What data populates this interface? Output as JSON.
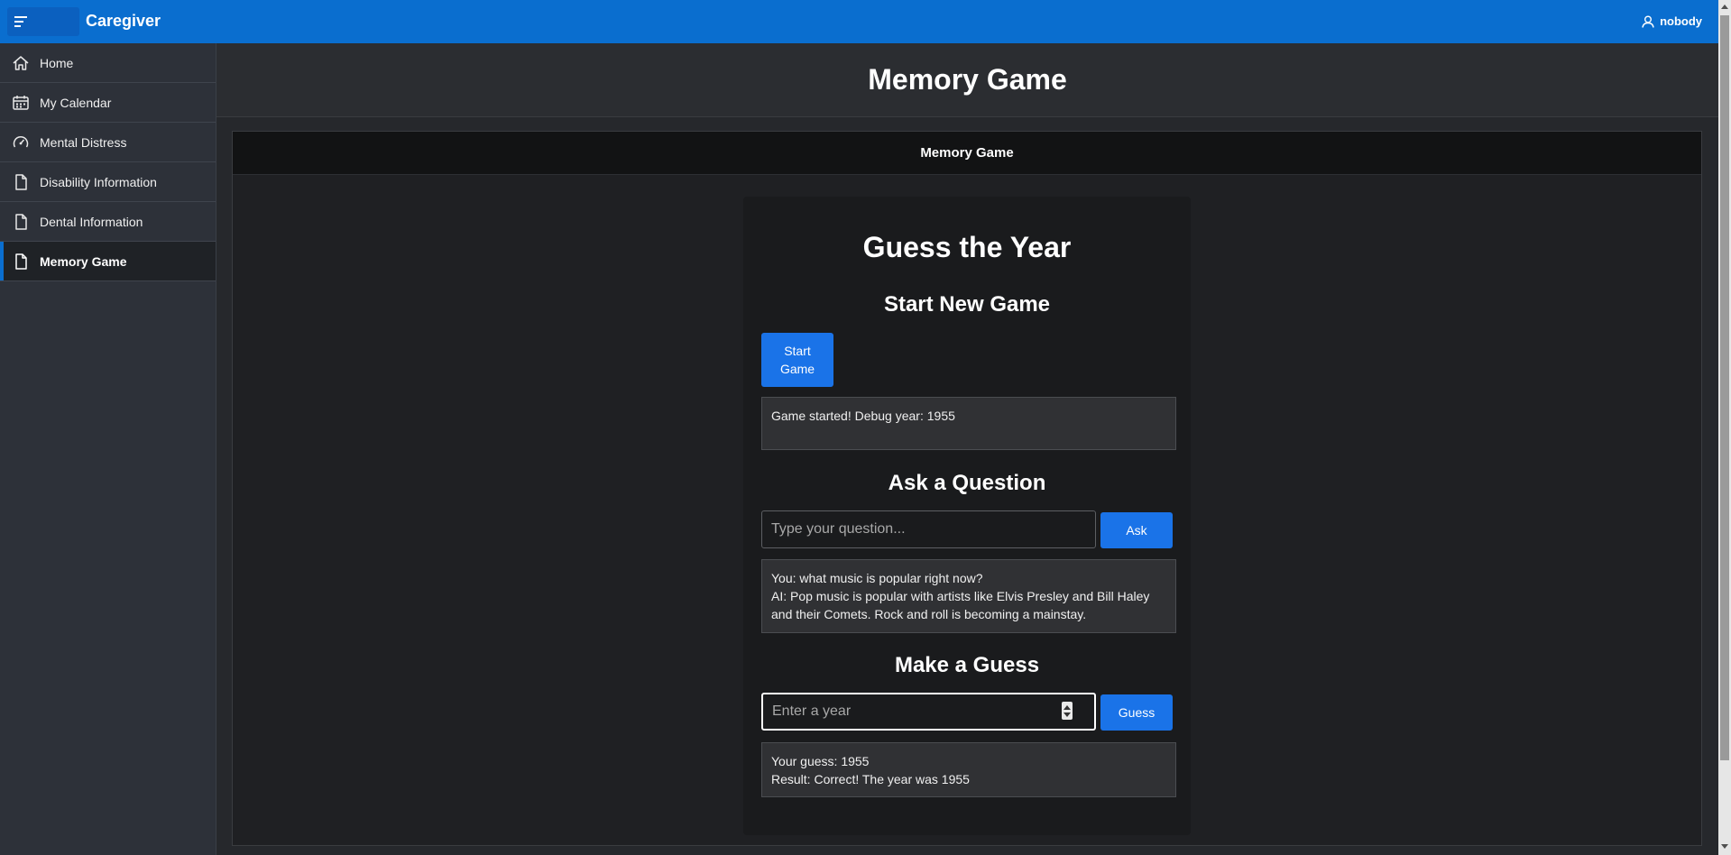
{
  "topbar": {
    "app_title": "Caregiver",
    "menu_icon": "hamburger-menu-icon",
    "user_icon": "user-icon",
    "user_name": "nobody",
    "accent_color": "#0a6ecf"
  },
  "sidebar": {
    "items": [
      {
        "label": "Home",
        "icon": "home-icon",
        "active": false
      },
      {
        "label": "My Calendar",
        "icon": "calendar-icon",
        "active": false
      },
      {
        "label": "Mental Distress",
        "icon": "gauge-icon",
        "active": false
      },
      {
        "label": "Disability Information",
        "icon": "document-icon",
        "active": false
      },
      {
        "label": "Dental Information",
        "icon": "document-icon",
        "active": false
      },
      {
        "label": "Memory Game",
        "icon": "document-icon",
        "active": true
      }
    ]
  },
  "page": {
    "title": "Memory Game",
    "region_title": "Memory Game"
  },
  "game": {
    "title": "Guess the Year",
    "start_section": "Start New Game",
    "start_button": "Start Game",
    "status_text": "Game started! Debug year: 1955",
    "ask_section": "Ask a Question",
    "question_placeholder": "Type your question...",
    "question_value": "",
    "ask_button": "Ask",
    "conversation": {
      "you_line": "You: what music is popular right now?",
      "ai_line": "AI: Pop music is popular with artists like Elvis Presley and Bill Haley and their Comets. Rock and roll is becoming a mainstay."
    },
    "guess_section": "Make a Guess",
    "year_placeholder": "Enter a year",
    "year_value": "",
    "guess_button": "Guess",
    "result": {
      "guess_line": "Your guess: 1955",
      "result_line": "Result: Correct! The year was 1955"
    }
  }
}
